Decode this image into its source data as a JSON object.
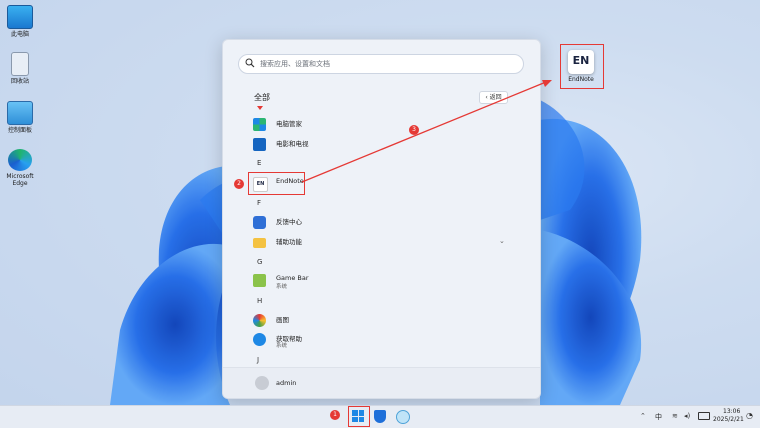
{
  "desktop": {
    "icons": [
      {
        "label": "此电脑"
      },
      {
        "label": "回收站"
      },
      {
        "label": "控制面板"
      },
      {
        "label": "Microsoft\nEdge"
      }
    ],
    "endnote_icon": {
      "text": "EN",
      "label": "EndNote"
    }
  },
  "start_menu": {
    "search_placeholder": "搜索应用、设置和文档",
    "section_title": "全部",
    "back_label": "返回",
    "letters": {
      "e": "E",
      "f": "F",
      "g": "G",
      "h": "H",
      "j": "J"
    },
    "apps": [
      {
        "name": "电脑管家",
        "sub": ""
      },
      {
        "name": "电影和电视",
        "sub": ""
      },
      {
        "name": "EndNote",
        "sub": ""
      },
      {
        "name": "反馈中心",
        "sub": ""
      },
      {
        "name": "辅助功能",
        "sub": ""
      },
      {
        "name": "Game Bar",
        "sub": "系统"
      },
      {
        "name": "画图",
        "sub": ""
      },
      {
        "name": "获取帮助",
        "sub": "系统"
      }
    ],
    "user": {
      "name": "admin"
    }
  },
  "annotations": {
    "step1": "1",
    "step2": "2",
    "step3": "3"
  },
  "taskbar": {
    "tray": {
      "ime": "中",
      "time": "13:06",
      "date": "2025/2/21"
    }
  }
}
